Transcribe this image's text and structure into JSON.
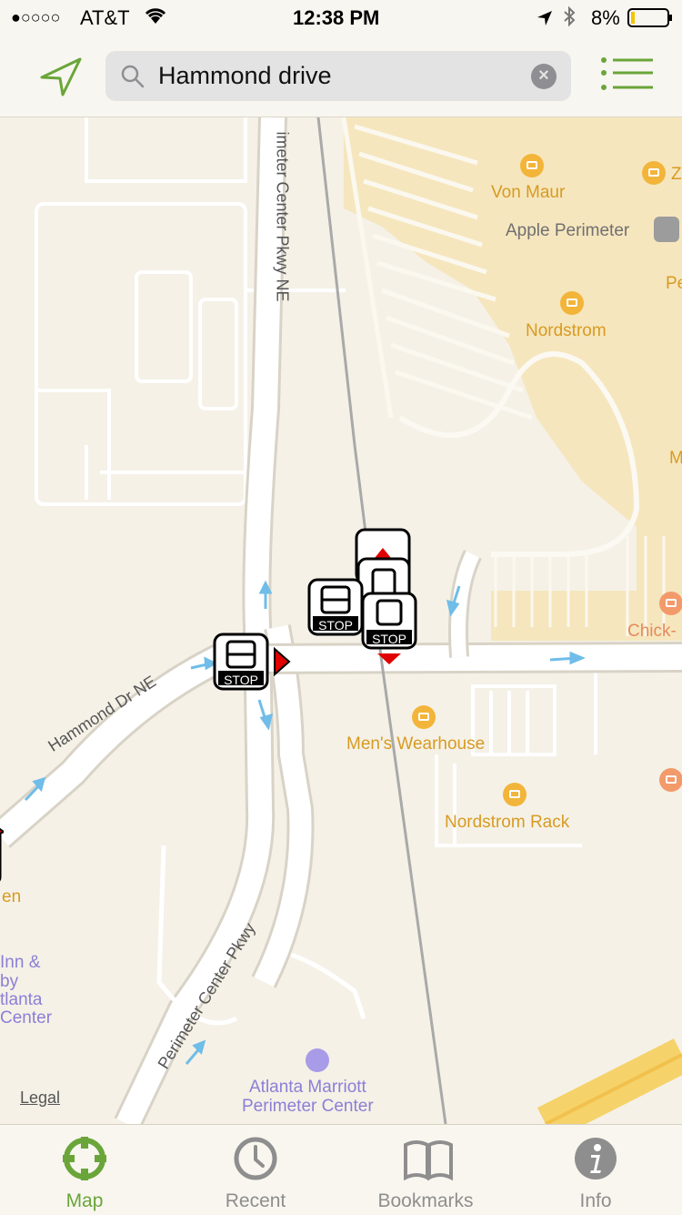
{
  "status_bar": {
    "signal": "●○○○○",
    "carrier": "AT&T",
    "time": "12:38 PM",
    "battery": "8%"
  },
  "search": {
    "query": "Hammond drive",
    "clear_symbol": "×"
  },
  "map": {
    "roads": {
      "perimeter_center_pkwy_ne": "imeter Center Pkwy NE",
      "hammond_dr_ne": "Hammond Dr NE",
      "perimeter_center_pkwy": "Perimeter Center Pkwy"
    },
    "places": {
      "von_maur": "Von Maur",
      "apple_perimeter": "Apple Perimeter",
      "nordstrom": "Nordstrom",
      "mens_wearhouse": "Men's Wearhouse",
      "nordstrom_rack": "Nordstrom Rack",
      "chick": "Chick-",
      "z_edge": "Z",
      "pe_edge": "Pe",
      "m_edge": "M",
      "en_edge": "en",
      "inn_line1": "Inn &",
      "inn_line2": "by",
      "inn_line3": "tlanta",
      "inn_line4": "Center",
      "marriott_line1": "Atlanta Marriott",
      "marriott_line2": "Perimeter Center"
    },
    "stop_label": "STOP",
    "legal": "Legal"
  },
  "tabs": [
    {
      "label": "Map",
      "icon": "map-target-icon",
      "active": true
    },
    {
      "label": "Recent",
      "icon": "clock-icon",
      "active": false
    },
    {
      "label": "Bookmarks",
      "icon": "book-icon",
      "active": false
    },
    {
      "label": "Info",
      "icon": "info-icon",
      "active": false
    }
  ],
  "colors": {
    "accent": "#6aa53a",
    "poi": "#d79b22",
    "hotel": "#8b7fd6",
    "mall": "#f6e6be",
    "arrow": "#6fbde8"
  }
}
